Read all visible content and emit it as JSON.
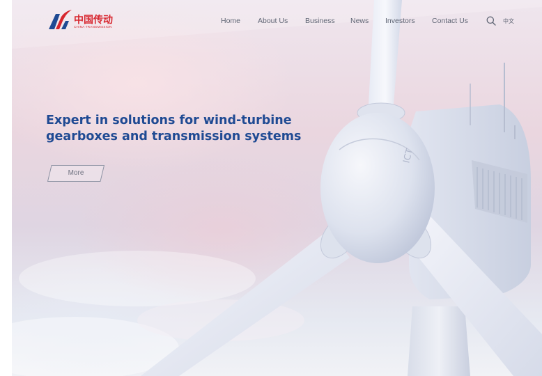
{
  "header": {
    "logo": {
      "cn": "中国传动",
      "en": "China Transmission"
    },
    "nav": [
      {
        "label": "Home"
      },
      {
        "label": "About Us"
      },
      {
        "label": "Business"
      },
      {
        "label": "News"
      },
      {
        "label": "Investors"
      },
      {
        "label": "Contact Us"
      }
    ],
    "search_icon": "search-icon",
    "language": "中文"
  },
  "hero": {
    "headline": "Expert in solutions for wind-turbine gearboxes and transmission systems",
    "more_label": "More",
    "image": "wind-turbine-hub-and-blades"
  },
  "colors": {
    "brand_red": "#d7262e",
    "headline_blue": "#1f4a93",
    "nav_text": "#5f6574"
  }
}
